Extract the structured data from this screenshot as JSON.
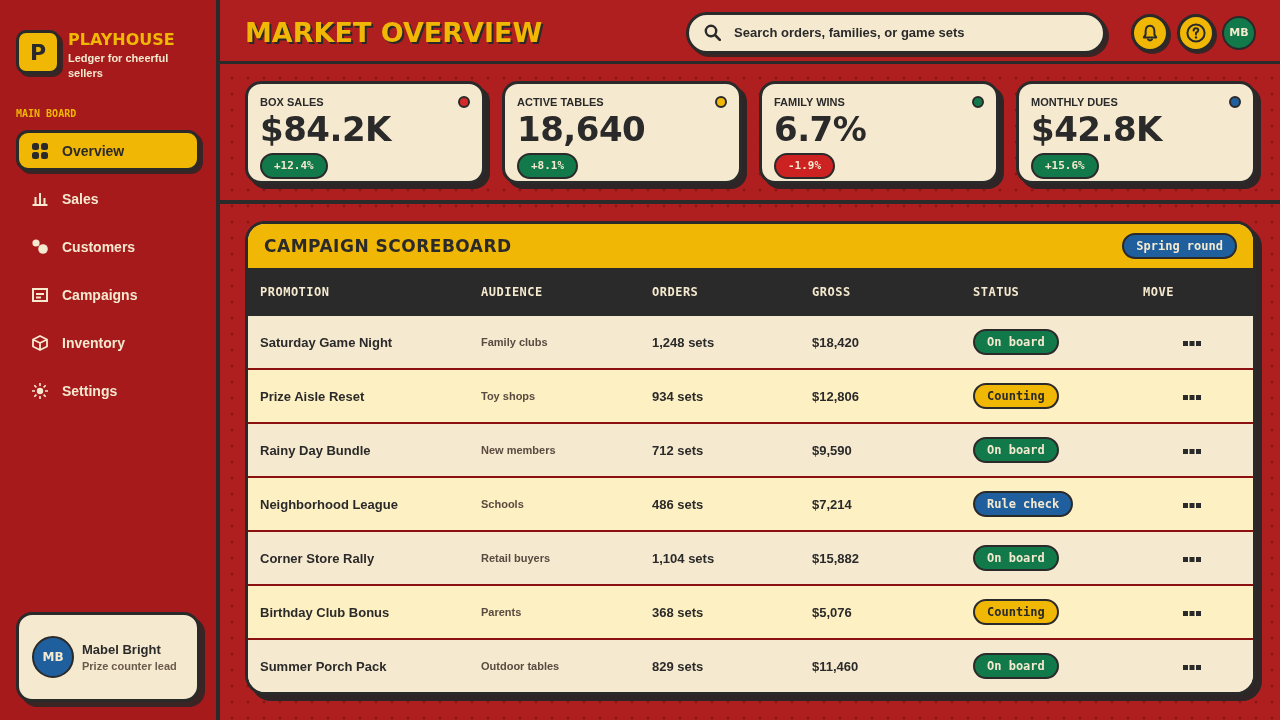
{
  "sidebar": {
    "brand": {
      "logo": "P",
      "name": "PLAYHOUSE",
      "tagline": "Ledger for cheerful sellers"
    },
    "section_label": "MAIN BOARD",
    "items": [
      {
        "label": "Overview",
        "selected": true
      },
      {
        "label": "Sales",
        "selected": false
      },
      {
        "label": "Customers",
        "selected": false
      },
      {
        "label": "Campaigns",
        "selected": false
      },
      {
        "label": "Inventory",
        "selected": false
      },
      {
        "label": "Settings",
        "selected": false
      }
    ],
    "user": {
      "initials": "MB",
      "name": "Mabel Bright",
      "role": "Prize counter lead"
    }
  },
  "header": {
    "title": "MARKET OVERVIEW",
    "search": {
      "placeholder": "Search orders, families, or game sets"
    },
    "avatar": "MB"
  },
  "kpis": [
    {
      "label": "BOX SALES",
      "value": "$84.2K",
      "color": "#d42a2a",
      "delta": {
        "text": "+12.4%",
        "color": "#127a4a"
      }
    },
    {
      "label": "ACTIVE TABLES",
      "value": "18,640",
      "color": "#f0b705",
      "delta": {
        "text": "+8.1%",
        "color": "#127a4a"
      }
    },
    {
      "label": "FAMILY WINS",
      "value": "6.7%",
      "color": "#127a4a",
      "delta": {
        "text": "-1.9%",
        "color": "#cc2222"
      }
    },
    {
      "label": "MONTHLY DUES",
      "value": "$42.8K",
      "color": "#1f5f9e",
      "delta": {
        "text": "+15.6%",
        "color": "#127a4a"
      }
    }
  ],
  "scoreboard": {
    "title": "CAMPAIGN SCOREBOARD",
    "badge": "Spring round",
    "columns": [
      "PROMOTION",
      "AUDIENCE",
      "ORDERS",
      "GROSS",
      "STATUS",
      "MOVE"
    ],
    "rows": [
      {
        "promotion": "Saturday Game Night",
        "audience": "Family clubs",
        "orders": "1,248 sets",
        "gross": "$18,420",
        "status": {
          "label": "On board",
          "color": "#127a4a"
        }
      },
      {
        "promotion": "Prize Aisle Reset",
        "audience": "Toy shops",
        "orders": "934 sets",
        "gross": "$12,806",
        "status": {
          "label": "Counting",
          "color": "#f0b705"
        }
      },
      {
        "promotion": "Rainy Day Bundle",
        "audience": "New members",
        "orders": "712 sets",
        "gross": "$9,590",
        "status": {
          "label": "On board",
          "color": "#127a4a"
        }
      },
      {
        "promotion": "Neighborhood League",
        "audience": "Schools",
        "orders": "486 sets",
        "gross": "$7,214",
        "status": {
          "label": "Rule check",
          "color": "#1f5f9e"
        }
      },
      {
        "promotion": "Corner Store Rally",
        "audience": "Retail buyers",
        "orders": "1,104 sets",
        "gross": "$15,882",
        "status": {
          "label": "On board",
          "color": "#127a4a"
        }
      },
      {
        "promotion": "Birthday Club Bonus",
        "audience": "Parents",
        "orders": "368 sets",
        "gross": "$5,076",
        "status": {
          "label": "Counting",
          "color": "#f0b705"
        }
      },
      {
        "promotion": "Summer Porch Pack",
        "audience": "Outdoor tables",
        "orders": "829 sets",
        "gross": "$11,460",
        "status": {
          "label": "On board",
          "color": "#127a4a"
        }
      }
    ]
  }
}
